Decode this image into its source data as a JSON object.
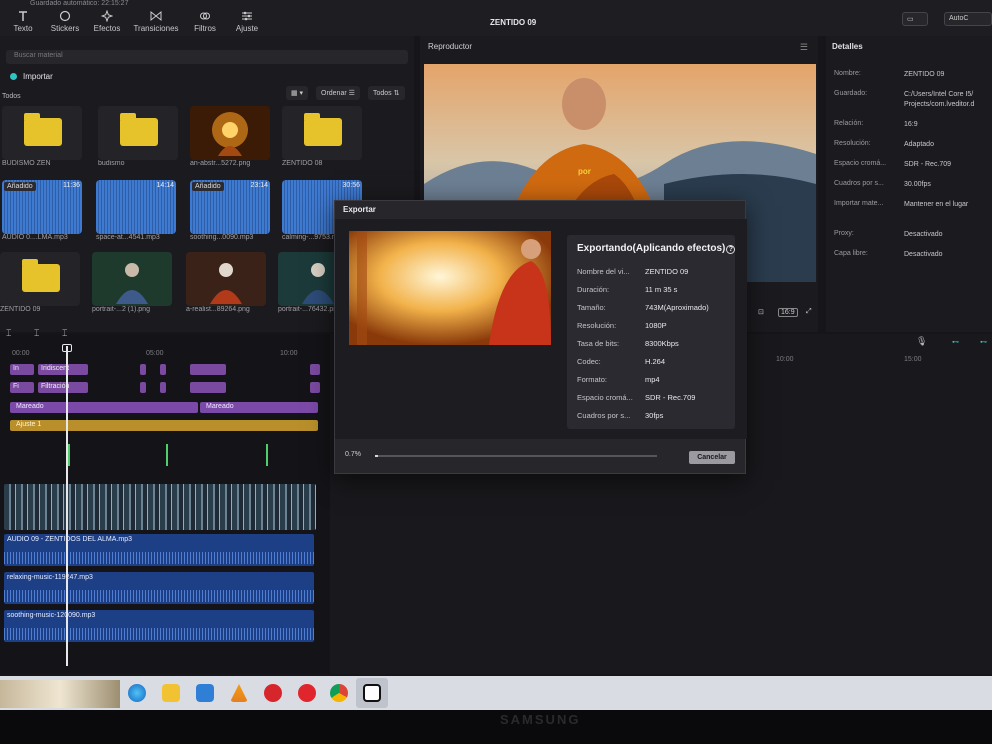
{
  "app": {
    "save_status": "Guardado automático: 22:15:27",
    "project_title": "ZENTIDO 09",
    "top_right_button": "AutoC"
  },
  "toolbar": [
    {
      "label": "Texto",
      "icon": "text-icon"
    },
    {
      "label": "Stickers",
      "icon": "sticker-icon"
    },
    {
      "label": "Efectos",
      "icon": "sparkle-icon"
    },
    {
      "label": "Transiciones",
      "icon": "transition-icon"
    },
    {
      "label": "Filtros",
      "icon": "filter-icon"
    },
    {
      "label": "Ajuste",
      "icon": "sliders-icon"
    }
  ],
  "media": {
    "search_placeholder": "Buscar material",
    "import_label": "Importar",
    "section_label": "Todos",
    "sort_label": "Ordenar",
    "filter_label": "Todos",
    "items": [
      {
        "name": "BUDISMO ZEN",
        "kind": "folder"
      },
      {
        "name": "budismo",
        "kind": "folder"
      },
      {
        "name": "an-abstr...5272.png",
        "kind": "image"
      },
      {
        "name": "ZENTIDO 08",
        "kind": "folder"
      },
      {
        "name": "AUDIO 0....LMA.mp3",
        "kind": "audio",
        "badge": "Añadido",
        "duration": "11:36"
      },
      {
        "name": "space-at...4541.mp3",
        "kind": "audio",
        "duration": "14:14"
      },
      {
        "name": "soothing...0090.mp3",
        "kind": "audio",
        "badge": "Añadido",
        "duration": "23:14"
      },
      {
        "name": "calming-...9753.mp3",
        "kind": "audio",
        "duration": "30:56"
      },
      {
        "name": "ZENTIDO 09",
        "kind": "folder"
      },
      {
        "name": "portrait-...2 (1).png",
        "kind": "image"
      },
      {
        "name": "a-realist...89264.png",
        "kind": "image"
      },
      {
        "name": "portrait-...76432.png",
        "kind": "image"
      }
    ]
  },
  "player": {
    "title": "Reproductor",
    "subtitle_text": "por",
    "ratio_label": "16:9"
  },
  "details": {
    "title": "Detalles",
    "rows": [
      {
        "k": "Nombre:",
        "v": "ZENTIDO 09"
      },
      {
        "k": "Guardado:",
        "v": "C:/Users/Intel Core I5/\nProjects/com.lveditor.d"
      },
      {
        "k": "Relación:",
        "v": "16:9"
      },
      {
        "k": "Resolución:",
        "v": "Adaptado"
      },
      {
        "k": "Espacio cromá...",
        "v": "SDR - Rec.709"
      },
      {
        "k": "Cuadros por s...",
        "v": "30.00fps"
      },
      {
        "k": "Importar mate...",
        "v": "Mantener en el lugar"
      },
      {
        "k": "Proxy:",
        "v": "Desactivado"
      },
      {
        "k": "Capa libre:",
        "v": "Desactivado"
      }
    ]
  },
  "timeline": {
    "ruler": [
      "00:00",
      "05:00",
      "10:00",
      "10:00",
      "15:00"
    ],
    "chips_row1": [
      "In",
      "Iridiscent"
    ],
    "chips_row2": [
      "Fi",
      "Filtración"
    ],
    "mareado_1": "Mareado",
    "mareado_2": "Mareado",
    "ajuste": "Ajuste 1",
    "audio_tracks": [
      "AUDIO 09 - ZENTIDOS DEL ALMA.mp3",
      "relaxing-music-119247.mp3",
      "soothing-music-120090.mp3"
    ]
  },
  "export_dialog": {
    "title": "Exportar",
    "heading": "Exportando(Aplicando efectos)",
    "rows": [
      {
        "k": "Nombre del vi...",
        "v": "ZENTIDO 09"
      },
      {
        "k": "Duración:",
        "v": "11 m 35 s"
      },
      {
        "k": "Tamaño:",
        "v": "743M(Aproximado)"
      },
      {
        "k": "Resolución:",
        "v": "1080P"
      },
      {
        "k": "Tasa de bits:",
        "v": "8300Kbps"
      },
      {
        "k": "Codec:",
        "v": "H.264"
      },
      {
        "k": "Formato:",
        "v": "mp4"
      },
      {
        "k": "Espacio cromá...",
        "v": "SDR - Rec.709"
      },
      {
        "k": "Cuadros por s...",
        "v": "30fps"
      }
    ],
    "progress_label": "0.7%",
    "progress_fraction": 0.007,
    "cancel_label": "Cancelar"
  },
  "monitor": {
    "brand": "SAMSUNG"
  },
  "colors": {
    "accent": "#2ec4c4",
    "folder": "#e6c32a",
    "effect_purple": "#7b4aa8",
    "adjust_yellow": "#b88f2a",
    "audio_blue": "#1d3f86"
  }
}
